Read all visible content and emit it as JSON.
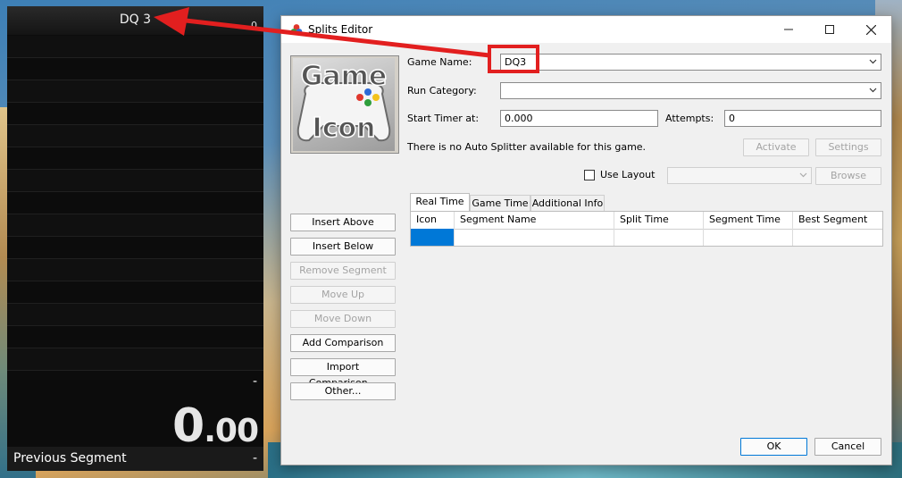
{
  "livesplit": {
    "game_name": "DQ 3",
    "attempts": "0",
    "split_rows": 15,
    "last_split_value": "-",
    "timer_main": "0",
    "timer_fraction": ".00",
    "previous_segment_label": "Previous Segment",
    "previous_segment_value": "-"
  },
  "dialog": {
    "title": "Splits Editor",
    "game_icon_text": [
      "Game",
      "Icon"
    ],
    "game_name_label": "Game Name:",
    "game_name_value": "DQ3",
    "run_category_label": "Run Category:",
    "run_category_value": "",
    "start_timer_label": "Start Timer at:",
    "start_timer_value": "0.000",
    "attempts_label": "Attempts:",
    "attempts_value": "0",
    "autosplitter_text": "There is no Auto Splitter available for this game.",
    "activate_label": "Activate",
    "settings_label": "Settings",
    "use_layout_label": "Use Layout",
    "use_layout_checked": false,
    "browse_label": "Browse",
    "side_buttons": {
      "insert_above": "Insert Above",
      "insert_below": "Insert Below",
      "remove_segment": "Remove Segment",
      "move_up": "Move Up",
      "move_down": "Move Down",
      "add_comparison": "Add Comparison",
      "import_comparison": "Import Comparison...",
      "other": "Other..."
    },
    "tabs": [
      "Real Time",
      "Game Time",
      "Additional Info"
    ],
    "active_tab": "Real Time",
    "grid_columns": [
      "Icon",
      "Segment Name",
      "Split Time",
      "Segment Time",
      "Best Segment"
    ],
    "ok_label": "OK",
    "cancel_label": "Cancel"
  },
  "colors": {
    "annotation": "#e21f1f",
    "selection": "#0078d7"
  }
}
